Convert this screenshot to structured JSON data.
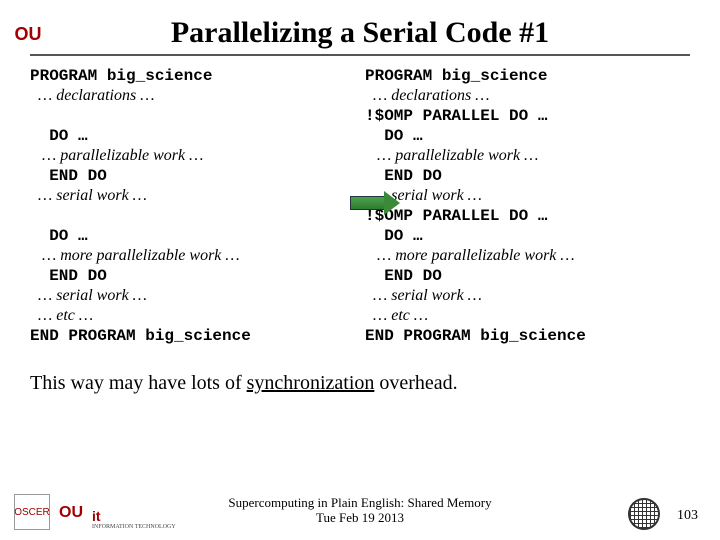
{
  "title": "Parallelizing a Serial Code #1",
  "left_code": {
    "l1": "PROGRAM big_science",
    "l2": "  … declarations …",
    "l3": "  DO …",
    "l4": "   … parallelizable work …",
    "l5": "  END DO",
    "l6": "  … serial work …",
    "l7": "  DO …",
    "l8": "   … more parallelizable work …",
    "l9": "  END DO",
    "l10": "  … serial work …",
    "l11": "  … etc …",
    "l12": "END PROGRAM big_science"
  },
  "right_code": {
    "l1": "PROGRAM big_science",
    "l2": "  … declarations …",
    "l3": "!$OMP PARALLEL DO …",
    "l4": "  DO …",
    "l5": "   … parallelizable work …",
    "l6": "  END DO",
    "l7": "  … serial work …",
    "l8": "!$OMP PARALLEL DO …",
    "l9": "  DO …",
    "l10": "   … more parallelizable work …",
    "l11": "  END DO",
    "l12": "  … serial work …",
    "l13": "  … etc …",
    "l14": "END PROGRAM big_science"
  },
  "note_pre": "This way may have lots of ",
  "note_sync": "synchronization",
  "note_post": " overhead.",
  "footer_line1": "Supercomputing in Plain English: Shared Memory",
  "footer_line2": "Tue Feb 19 2013",
  "page_number": "103",
  "logos": {
    "top": "OU",
    "oscer": "OSCER",
    "ou": "OU",
    "it": "it",
    "it_sub": "INFORMATION TECHNOLOGY"
  }
}
